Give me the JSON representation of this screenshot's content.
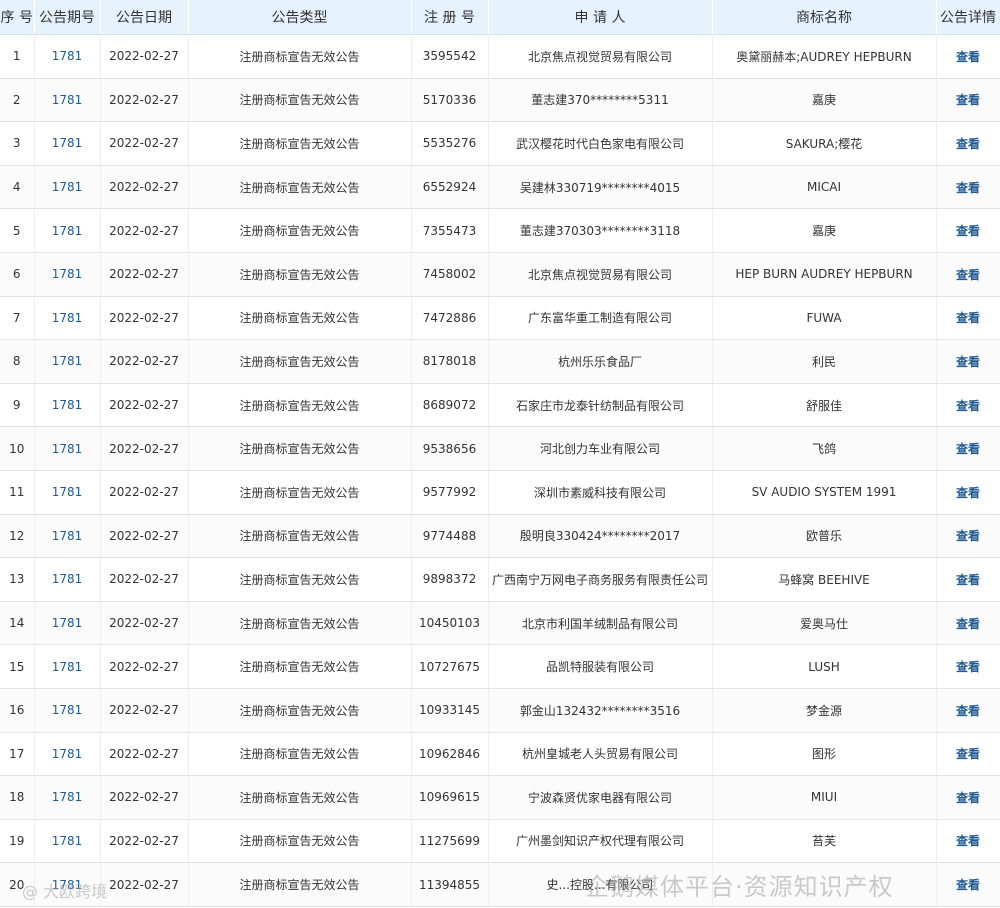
{
  "headers": [
    "序 号",
    "公告期号",
    "公告日期",
    "公告类型",
    "注 册 号",
    "申 请 人",
    "商标名称",
    "公告详情"
  ],
  "rows": [
    {
      "no": "1",
      "issue": "1781",
      "date": "2022-02-27",
      "type": "注册商标宣告无效公告",
      "reg": "3595542",
      "applicant": "北京焦点视觉贸易有限公司",
      "mark": "奥黛丽赫本;AUDREY HEPBURN",
      "detail": "查看"
    },
    {
      "no": "2",
      "issue": "1781",
      "date": "2022-02-27",
      "type": "注册商标宣告无效公告",
      "reg": "5170336",
      "applicant": "董志建370********5311",
      "mark": "嘉庚",
      "detail": "查看"
    },
    {
      "no": "3",
      "issue": "1781",
      "date": "2022-02-27",
      "type": "注册商标宣告无效公告",
      "reg": "5535276",
      "applicant": "武汉樱花时代白色家电有限公司",
      "mark": "SAKURA;樱花",
      "detail": "查看"
    },
    {
      "no": "4",
      "issue": "1781",
      "date": "2022-02-27",
      "type": "注册商标宣告无效公告",
      "reg": "6552924",
      "applicant": "吴建林330719********4015",
      "mark": "MICAI",
      "detail": "查看"
    },
    {
      "no": "5",
      "issue": "1781",
      "date": "2022-02-27",
      "type": "注册商标宣告无效公告",
      "reg": "7355473",
      "applicant": "董志建370303********3118",
      "mark": "嘉庚",
      "detail": "查看"
    },
    {
      "no": "6",
      "issue": "1781",
      "date": "2022-02-27",
      "type": "注册商标宣告无效公告",
      "reg": "7458002",
      "applicant": "北京焦点视觉贸易有限公司",
      "mark": "HEP BURN AUDREY HEPBURN",
      "detail": "查看"
    },
    {
      "no": "7",
      "issue": "1781",
      "date": "2022-02-27",
      "type": "注册商标宣告无效公告",
      "reg": "7472886",
      "applicant": "广东富华重工制造有限公司",
      "mark": "FUWA",
      "detail": "查看"
    },
    {
      "no": "8",
      "issue": "1781",
      "date": "2022-02-27",
      "type": "注册商标宣告无效公告",
      "reg": "8178018",
      "applicant": "杭州乐乐食品厂",
      "mark": "利民",
      "detail": "查看"
    },
    {
      "no": "9",
      "issue": "1781",
      "date": "2022-02-27",
      "type": "注册商标宣告无效公告",
      "reg": "8689072",
      "applicant": "石家庄市龙泰针纺制品有限公司",
      "mark": "舒服佳",
      "detail": "查看"
    },
    {
      "no": "10",
      "issue": "1781",
      "date": "2022-02-27",
      "type": "注册商标宣告无效公告",
      "reg": "9538656",
      "applicant": "河北创力车业有限公司",
      "mark": "飞鸽",
      "detail": "查看"
    },
    {
      "no": "11",
      "issue": "1781",
      "date": "2022-02-27",
      "type": "注册商标宣告无效公告",
      "reg": "9577992",
      "applicant": "深圳市素威科技有限公司",
      "mark": "SV AUDIO SYSTEM 1991",
      "detail": "查看"
    },
    {
      "no": "12",
      "issue": "1781",
      "date": "2022-02-27",
      "type": "注册商标宣告无效公告",
      "reg": "9774488",
      "applicant": "殷明良330424********2017",
      "mark": "欧普乐",
      "detail": "查看"
    },
    {
      "no": "13",
      "issue": "1781",
      "date": "2022-02-27",
      "type": "注册商标宣告无效公告",
      "reg": "9898372",
      "applicant": "广西南宁万网电子商务服务有限责任公司",
      "mark": "马蜂窝 BEEHIVE",
      "detail": "查看"
    },
    {
      "no": "14",
      "issue": "1781",
      "date": "2022-02-27",
      "type": "注册商标宣告无效公告",
      "reg": "10450103",
      "applicant": "北京市利国羊绒制品有限公司",
      "mark": "爱奥马仕",
      "detail": "查看"
    },
    {
      "no": "15",
      "issue": "1781",
      "date": "2022-02-27",
      "type": "注册商标宣告无效公告",
      "reg": "10727675",
      "applicant": "品凯特服装有限公司",
      "mark": "LUSH",
      "detail": "查看"
    },
    {
      "no": "16",
      "issue": "1781",
      "date": "2022-02-27",
      "type": "注册商标宣告无效公告",
      "reg": "10933145",
      "applicant": "郭金山132432********3516",
      "mark": "梦金源",
      "detail": "查看"
    },
    {
      "no": "17",
      "issue": "1781",
      "date": "2022-02-27",
      "type": "注册商标宣告无效公告",
      "reg": "10962846",
      "applicant": "杭州皇城老人头贸易有限公司",
      "mark": "图形",
      "detail": "查看"
    },
    {
      "no": "18",
      "issue": "1781",
      "date": "2022-02-27",
      "type": "注册商标宣告无效公告",
      "reg": "10969615",
      "applicant": "宁波森贤优家电器有限公司",
      "mark": "MIUI",
      "detail": "查看"
    },
    {
      "no": "19",
      "issue": "1781",
      "date": "2022-02-27",
      "type": "注册商标宣告无效公告",
      "reg": "11275699",
      "applicant": "广州墨剑知识产权代理有限公司",
      "mark": "苔芙",
      "detail": "查看"
    },
    {
      "no": "20",
      "issue": "1781",
      "date": "2022-02-27",
      "type": "注册商标宣告无效公告",
      "reg": "11394855",
      "applicant": "史...控股...有限公司",
      "mark": "",
      "detail": "查看"
    }
  ],
  "watermarks": {
    "left": "@ 大欧跨境",
    "right": "企鹅媒体平台·资源知识产权"
  },
  "colors": {
    "header_bg": "#e6f2fb",
    "link": "#1f5a94",
    "text": "#333333"
  }
}
